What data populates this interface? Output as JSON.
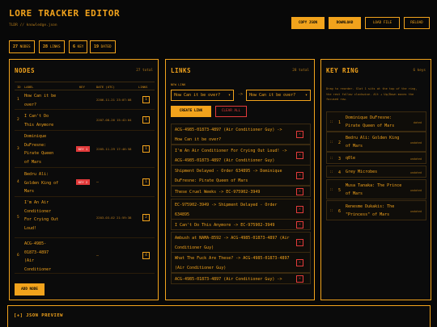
{
  "app": {
    "title": "LORE TRACKER EDITOR",
    "subtitle": "TLDR // knowledge.json"
  },
  "header_buttons": {
    "copy_json": "COPY JSON",
    "download": "DOWNLOAD",
    "load_file": "LOAD FILE",
    "reload": "RELOAD"
  },
  "stats": [
    {
      "value": "27",
      "label": "NODES"
    },
    {
      "value": "28",
      "label": "LINKS"
    },
    {
      "value": "6",
      "label": "KEY"
    },
    {
      "value": "19",
      "label": "DATED"
    }
  ],
  "nodes_panel": {
    "title": "NODES",
    "count": "27 total",
    "columns": [
      "ID",
      "LABEL",
      "KEY",
      "DATE (UTC)",
      "LINKS"
    ],
    "rows": [
      {
        "id": "1",
        "label_lines": [
          "How Can it be",
          "over?"
        ],
        "key": "",
        "date": "2206-11-21 23:07:08",
        "links": "1"
      },
      {
        "id": "2",
        "label_lines": [
          "I Can't Do",
          "This Anymore"
        ],
        "key": "",
        "date": "2207-08-26 15:42:04",
        "links": "1"
      },
      {
        "id": "3",
        "label_lines": [
          "Dominique",
          "DuFresne:",
          "Pirate Queen",
          "of Mars"
        ],
        "key": "KEY 1",
        "date": "2205-11-29 17:46:58",
        "links": "1"
      },
      {
        "id": "4",
        "label_lines": [
          "Bedru Ali:",
          "Golden King of",
          "Mars"
        ],
        "key": "KEY 2",
        "date": "–",
        "links": "1"
      },
      {
        "id": "5",
        "label_lines": [
          "I'm An Air",
          "Conditioner",
          "For Crying Out",
          "Loud!"
        ],
        "key": "",
        "date": "2203-03-02 21:59:38",
        "links": "2"
      },
      {
        "id": "6",
        "label_lines": [
          "ACG-4985-",
          "01873-4897",
          "(Air",
          "Conditioner"
        ],
        "key": "",
        "date": "–",
        "links": "4"
      }
    ],
    "add_button": "ADD NODE"
  },
  "links_panel": {
    "title": "LINKS",
    "count": "28 total",
    "new_link_label": "NEW LINK",
    "from_value": "How Can it be over?",
    "to_value": "How Can it be over?",
    "arrow": "->",
    "create_button": "CREATE LINK",
    "clear_button": "CLEAR ALL",
    "remove_glyph": "×",
    "items": [
      {
        "lines": [
          "ACG-4985-01873-4897 (Air Conditioner Guy) ->",
          "How Can it be over?"
        ]
      },
      {
        "lines": [
          "I'm An Air Conditioner For Crying Out Loud! ->",
          "ACG-4985-01873-4897 (Air Conditioner Guy)"
        ]
      },
      {
        "lines": [
          "Shipment Delayed - Order 634895 -> Dominique",
          "DuFresne: Pirate Queen of Mars"
        ]
      },
      {
        "lines": [
          "These Cruel Weeks -> EC-975902-3949"
        ]
      },
      {
        "lines": [
          "EC-975902-3949 -> Shipment Delayed - Order",
          "634895"
        ]
      },
      {
        "lines": [
          "I Can't Do This Anymore -> EC-975902-3949"
        ]
      },
      {
        "lines": [
          "Ambush at NAMA-8592 -> ACG-4985-01873-4897 (Air",
          "Conditioner Guy)"
        ]
      },
      {
        "lines": [
          "What The Fuck Are These? -> ACG-4985-01873-4897",
          "(Air Conditioner Guy)"
        ]
      },
      {
        "lines": [
          "ACG-4985-01873-4897 (Air Conditioner Guy) ->"
        ]
      }
    ]
  },
  "keyring_panel": {
    "title": "KEY RING",
    "count": "6 keys",
    "help_lines": [
      "Drag to reorder. Slot 1 sits at the top of the ring,",
      "the rest follow clockwise. Alt + Up/Down moves the",
      "focused row."
    ],
    "grip": "::",
    "items": [
      {
        "n": "1",
        "lines": [
          "Dominique DuFresne:",
          "Pirate Queen of Mars"
        ],
        "date": "dated"
      },
      {
        "n": "2",
        "lines": [
          "Bedru Ali: Golden King",
          "of Mars"
        ],
        "date": "undated"
      },
      {
        "n": "3",
        "lines": [
          "q0le"
        ],
        "date": "undated"
      },
      {
        "n": "4",
        "lines": [
          "Grey Microbes"
        ],
        "date": "undated"
      },
      {
        "n": "5",
        "lines": [
          "Musa Tanaka: The Prince",
          "of Mars"
        ],
        "date": "undated"
      },
      {
        "n": "6",
        "lines": [
          "Renesme Dukakis: The",
          "\"Princess\" of Mars"
        ],
        "date": "undated"
      }
    ]
  },
  "json_preview": {
    "title": "[+] JSON PREVIEW"
  },
  "colors": {
    "accent": "#f2a31c",
    "background": "#080808",
    "danger": "#e23a3a"
  }
}
